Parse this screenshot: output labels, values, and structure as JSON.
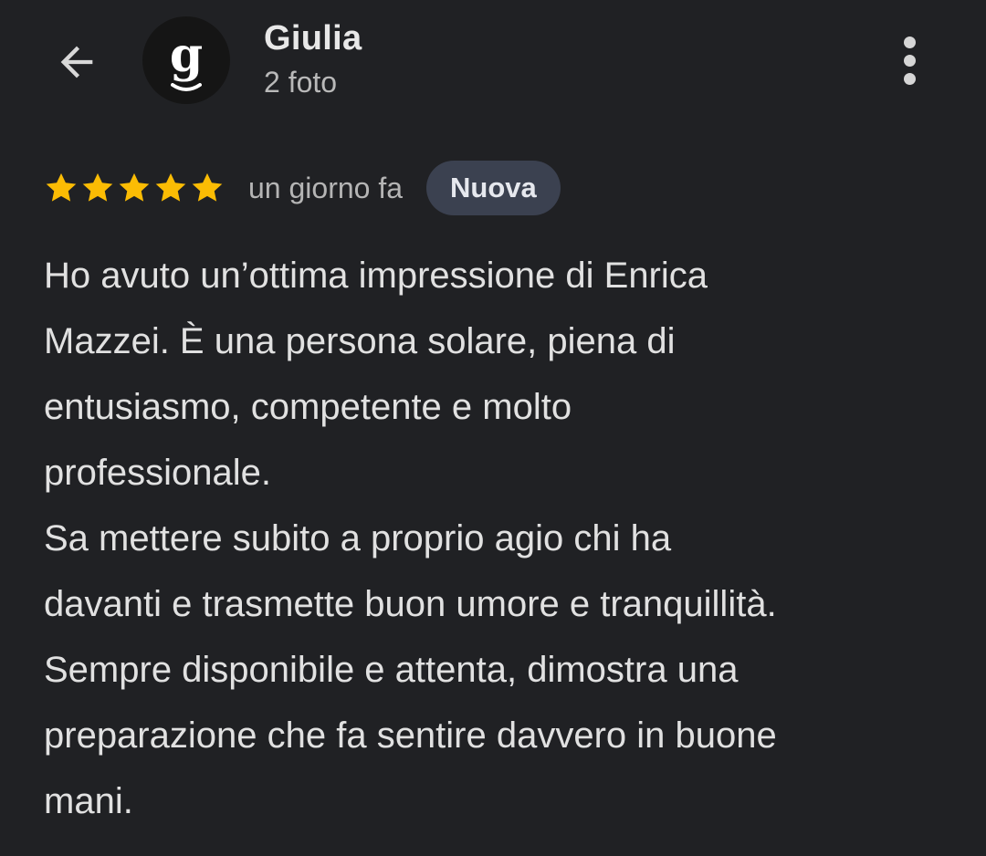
{
  "header": {
    "user_name": "Giulia",
    "photo_count": "2 foto",
    "avatar_letter": "g",
    "back_icon": "arrow-left-icon",
    "menu_icon": "more-vert-icon"
  },
  "review": {
    "rating": 5,
    "rating_max": 5,
    "star_color": "#fbbc04",
    "time": "un giorno fa",
    "badge": "Nuova",
    "lines": [
      "Ho avuto un’ottima impressione di Enrica",
      "Mazzei. È una persona solare, piena di",
      "entusiasmo, competente e molto",
      "professionale.",
      "Sa mettere subito a proprio agio chi ha",
      "davanti e trasmette buon umore e tranquillità.",
      "Sempre disponibile e attenta, dimostra una",
      "preparazione che fa sentire davvero in buone",
      "mani."
    ]
  },
  "colors": {
    "background": "#202124",
    "text_primary": "#e3e3e3",
    "text_secondary": "#b5b5b5",
    "badge_bg": "#3b4150"
  }
}
